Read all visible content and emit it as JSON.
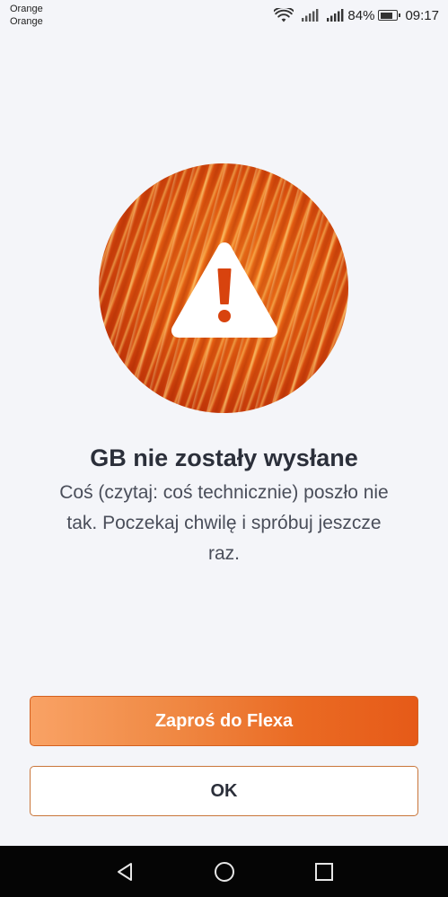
{
  "status_bar": {
    "carrier_1": "Orange",
    "carrier_2": "Orange",
    "battery_percent": "84%",
    "battery_level": 0.84,
    "time": "09:17",
    "icons": [
      "wifi-icon",
      "signal-icon",
      "signal-icon",
      "battery-icon"
    ]
  },
  "hero": {
    "icon": "warning-icon",
    "colors": {
      "circle_dark": "#c9380a",
      "circle_light": "#f47a1c",
      "icon": "#ffffff"
    }
  },
  "error": {
    "title": "GB nie zostały wysłane",
    "message": "Coś (czytaj: coś technicznie) poszło nie tak. Poczekaj chwilę i spróbuj jeszcze raz."
  },
  "buttons": {
    "primary_label": "Zaproś do Flexa",
    "secondary_label": "OK"
  },
  "nav_bar": {
    "icons": [
      "back-icon",
      "home-icon",
      "recent-apps-icon"
    ]
  },
  "colors": {
    "accent": "#ea6a23",
    "background": "#f4f5f9",
    "text": "#2b2f3a"
  }
}
